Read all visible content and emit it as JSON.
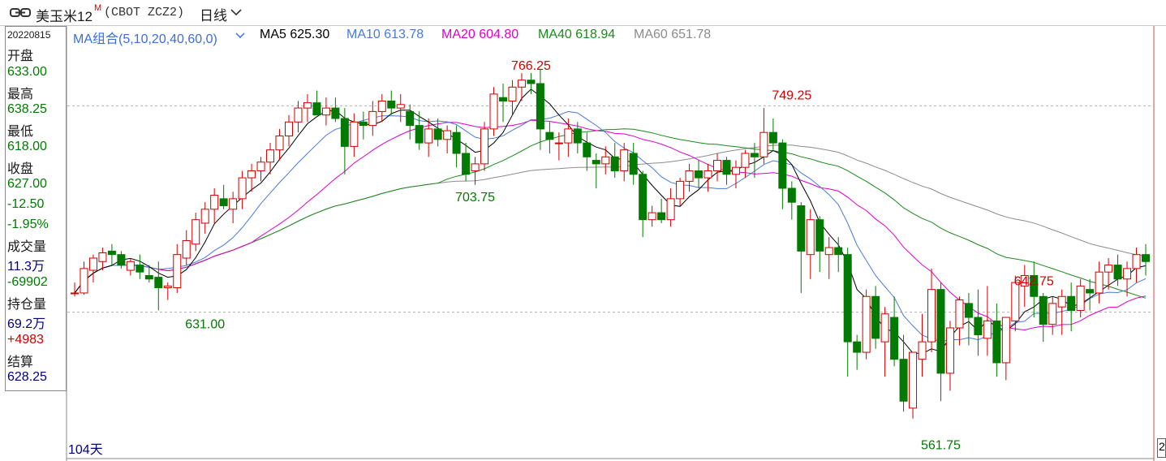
{
  "title": {
    "name": "美玉米12",
    "superscript": "M",
    "code": "(CBOT ZCZ2)",
    "period": "日线",
    "icon": "link-icon"
  },
  "info_panel": {
    "date": "20220815",
    "open_label": "开盘",
    "open": "633.00",
    "high_label": "最高",
    "high": "638.25",
    "low_label": "最低",
    "low": "618.00",
    "close_label": "收盘",
    "close": "627.00",
    "change": "-12.50",
    "change_pct": "-1.95%",
    "volume_label": "成交量",
    "volume": "11.3万",
    "volume_change": "-69902",
    "oi_label": "持仓量",
    "oi": "69.2万",
    "oi_change": "+4983",
    "settle_label": "结算",
    "settle": "628.25"
  },
  "legend": {
    "group": "MA组合(5,10,20,40,60,0)",
    "ma5": "MA5 625.30",
    "ma10": "MA10 613.78",
    "ma20": "MA20 604.80",
    "ma40": "MA40 618.94",
    "ma60": "MA60 651.78"
  },
  "colors": {
    "up": "#d00000",
    "down": "#007a00",
    "ma5": "#000000",
    "ma10": "#4a7ad8",
    "ma20": "#e000c8",
    "ma40": "#1a8a1a",
    "ma60": "#8c8c8c",
    "group": "#3a6ee0"
  },
  "footer": {
    "days": "104天",
    "scroll_label": "2"
  },
  "chart_data": {
    "type": "candlestick",
    "y_range": [
      555,
      782
    ],
    "reference_lines": [
      749.25,
      631.0
    ],
    "annotations": [
      {
        "index": 49,
        "price": 766.25,
        "label": "766.25",
        "color": "up"
      },
      {
        "index": 77,
        "price": 749.25,
        "label": "749.25",
        "color": "up"
      },
      {
        "index": 43,
        "price": 703.75,
        "label": "703.75",
        "color": "down"
      },
      {
        "index": 14,
        "price": 631.0,
        "label": "631.00",
        "color": "down"
      },
      {
        "index": 93,
        "price": 561.75,
        "label": "561.75",
        "color": "down"
      },
      {
        "index": 103,
        "price": 642.75,
        "label": "642.75",
        "color": "up"
      }
    ],
    "ohlc": [
      [
        642,
        648,
        640,
        642
      ],
      [
        642,
        660,
        641,
        656
      ],
      [
        655,
        664,
        648,
        662
      ],
      [
        660,
        668,
        655,
        665
      ],
      [
        666,
        670,
        658,
        664
      ],
      [
        664,
        666,
        656,
        658
      ],
      [
        655,
        662,
        652,
        660
      ],
      [
        658,
        664,
        650,
        654
      ],
      [
        652,
        658,
        648,
        650
      ],
      [
        651,
        660,
        632,
        645
      ],
      [
        645,
        648,
        638,
        646
      ],
      [
        645,
        670,
        642,
        664
      ],
      [
        662,
        678,
        658,
        672
      ],
      [
        670,
        688,
        666,
        684
      ],
      [
        682,
        694,
        676,
        690
      ],
      [
        690,
        702,
        682,
        698
      ],
      [
        696,
        704,
        690,
        692
      ],
      [
        690,
        700,
        682,
        696
      ],
      [
        696,
        712,
        690,
        708
      ],
      [
        708,
        716,
        700,
        712
      ],
      [
        712,
        720,
        706,
        717
      ],
      [
        717,
        728,
        710,
        724
      ],
      [
        724,
        736,
        718,
        732
      ],
      [
        732,
        744,
        726,
        740
      ],
      [
        740,
        752,
        734,
        748
      ],
      [
        748,
        756,
        740,
        751
      ],
      [
        751,
        758,
        745,
        744
      ],
      [
        744,
        754,
        738,
        748
      ],
      [
        748,
        754,
        740,
        742
      ],
      [
        742,
        748,
        710,
        726
      ],
      [
        726,
        745,
        720,
        740
      ],
      [
        740,
        746,
        730,
        738
      ],
      [
        738,
        752,
        732,
        746
      ],
      [
        746,
        756,
        740,
        752
      ],
      [
        752,
        758,
        744,
        748
      ],
      [
        748,
        756,
        740,
        750
      ],
      [
        746,
        750,
        730,
        738
      ],
      [
        738,
        746,
        724,
        728
      ],
      [
        728,
        742,
        720,
        736
      ],
      [
        736,
        742,
        726,
        730
      ],
      [
        730,
        738,
        722,
        735
      ],
      [
        734,
        738,
        714,
        722
      ],
      [
        722,
        728,
        706,
        710
      ],
      [
        712,
        720,
        704,
        716
      ],
      [
        716,
        740,
        712,
        736
      ],
      [
        736,
        760,
        732,
        756
      ],
      [
        754,
        762,
        740,
        752
      ],
      [
        752,
        764,
        744,
        760
      ],
      [
        760,
        768,
        752,
        764
      ],
      [
        764,
        768,
        756,
        762
      ],
      [
        762,
        770,
        724,
        736
      ],
      [
        734,
        740,
        722,
        730
      ],
      [
        728,
        734,
        718,
        728
      ],
      [
        728,
        742,
        720,
        736
      ],
      [
        736,
        740,
        722,
        728
      ],
      [
        728,
        734,
        712,
        720
      ],
      [
        718,
        722,
        702,
        716
      ],
      [
        716,
        726,
        710,
        720
      ],
      [
        720,
        728,
        708,
        712
      ],
      [
        712,
        728,
        706,
        724
      ],
      [
        722,
        728,
        704,
        710
      ],
      [
        710,
        712,
        674,
        684
      ],
      [
        684,
        692,
        680,
        688
      ],
      [
        688,
        696,
        682,
        684
      ],
      [
        684,
        702,
        680,
        696
      ],
      [
        696,
        708,
        692,
        706
      ],
      [
        706,
        716,
        700,
        712
      ],
      [
        712,
        718,
        702,
        708
      ],
      [
        708,
        716,
        700,
        712
      ],
      [
        712,
        722,
        706,
        718
      ],
      [
        718,
        720,
        704,
        710
      ],
      [
        710,
        718,
        702,
        714
      ],
      [
        714,
        724,
        708,
        722
      ],
      [
        722,
        728,
        708,
        720
      ],
      [
        720,
        748,
        716,
        734
      ],
      [
        734,
        742,
        724,
        728
      ],
      [
        728,
        730,
        690,
        702
      ],
      [
        702,
        706,
        684,
        694
      ],
      [
        692,
        694,
        642,
        666
      ],
      [
        664,
        690,
        650,
        684
      ],
      [
        684,
        686,
        654,
        666
      ],
      [
        664,
        674,
        650,
        668
      ],
      [
        668,
        674,
        654,
        664
      ],
      [
        664,
        668,
        594,
        614
      ],
      [
        614,
        618,
        598,
        608
      ],
      [
        608,
        644,
        604,
        640
      ],
      [
        640,
        646,
        610,
        616
      ],
      [
        614,
        634,
        594,
        630
      ],
      [
        628,
        640,
        600,
        604
      ],
      [
        604,
        618,
        574,
        580
      ],
      [
        576,
        608,
        570,
        608
      ],
      [
        604,
        630,
        594,
        614
      ],
      [
        614,
        656,
        608,
        644
      ],
      [
        644,
        648,
        580,
        596
      ],
      [
        596,
        626,
        586,
        622
      ],
      [
        622,
        640,
        612,
        638
      ],
      [
        636,
        642,
        612,
        628
      ],
      [
        628,
        644,
        606,
        618
      ],
      [
        616,
        646,
        606,
        626
      ],
      [
        626,
        636,
        594,
        602
      ],
      [
        602,
        628,
        592,
        628
      ],
      [
        626,
        652,
        620,
        648
      ],
      [
        646,
        658,
        634,
        652
      ],
      [
        652,
        660,
        628,
        640
      ],
      [
        640,
        642,
        614,
        624
      ],
      [
        624,
        640,
        618,
        636
      ],
      [
        634,
        644,
        618,
        640
      ],
      [
        640,
        648,
        620,
        632
      ],
      [
        632,
        650,
        628,
        646
      ],
      [
        644,
        650,
        632,
        642
      ],
      [
        642,
        660,
        636,
        654
      ],
      [
        654,
        662,
        644,
        658
      ],
      [
        658,
        664,
        646,
        650
      ],
      [
        650,
        660,
        640,
        656
      ],
      [
        656,
        668,
        648,
        664
      ],
      [
        664,
        670,
        652,
        660
      ]
    ]
  }
}
